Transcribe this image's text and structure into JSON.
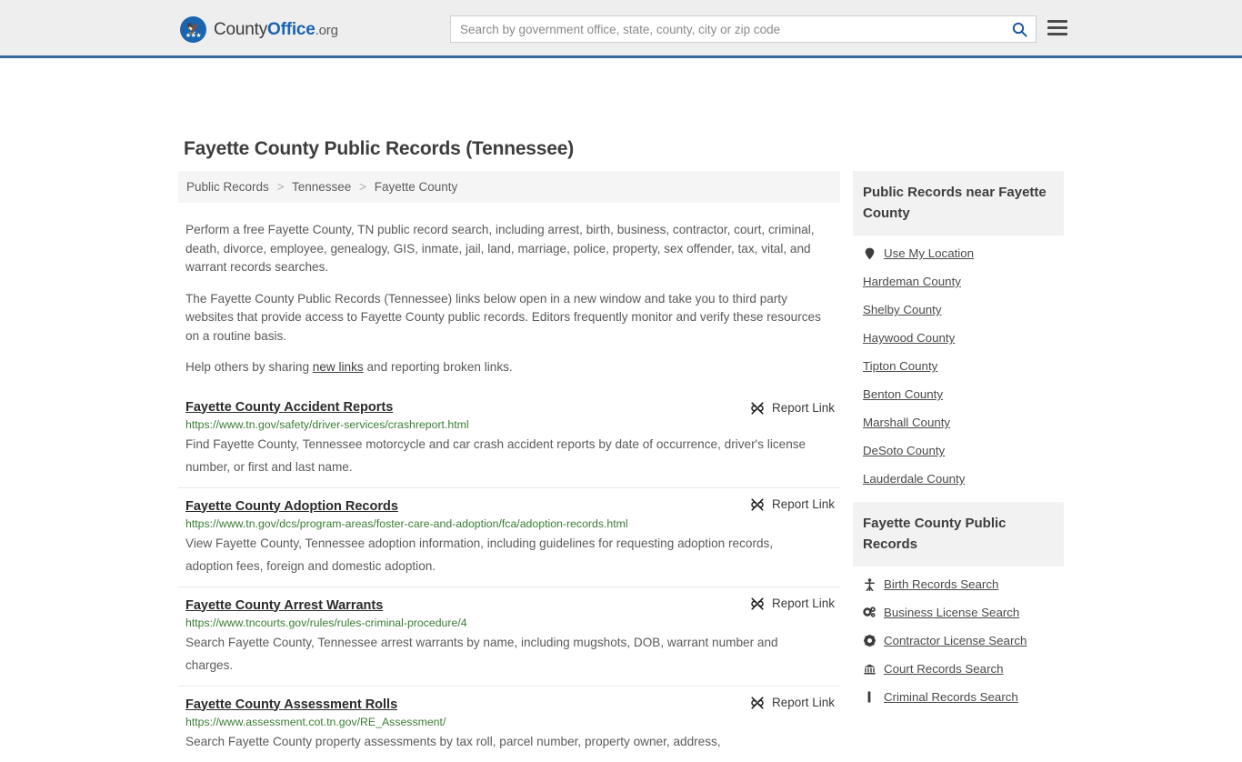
{
  "header": {
    "logo": {
      "prefix": "County",
      "bold": "Office",
      "suffix": ".org",
      "seal_icon": "eagle-seal-icon"
    },
    "search": {
      "placeholder": "Search by government office, state, county, city or zip code",
      "value": "",
      "search_icon": "search-icon"
    },
    "menu_icon": "hamburger-menu-icon"
  },
  "page": {
    "title": "Fayette County Public Records (Tennessee)"
  },
  "breadcrumb": {
    "separator": ">",
    "items": [
      {
        "label": "Public Records"
      },
      {
        "label": "Tennessee"
      },
      {
        "label": "Fayette County"
      }
    ]
  },
  "intro": {
    "p1": "Perform a free Fayette County, TN public record search, including arrest, birth, business, contractor, court, criminal, death, divorce, employee, genealogy, GIS, inmate, jail, land, marriage, police, property, sex offender, tax, vital, and warrant records searches.",
    "p2": "The Fayette County Public Records (Tennessee) links below open in a new window and take you to third party websites that provide access to Fayette County public records. Editors frequently monitor and verify these resources on a routine basis.",
    "p3_before": "Help others by sharing ",
    "p3_link": "new links",
    "p3_after": " and reporting broken links."
  },
  "results": {
    "report_label": "Report Link",
    "report_icon": "broken-link-icon",
    "items": [
      {
        "title": "Fayette County Accident Reports",
        "url": "https://www.tn.gov/safety/driver-services/crashreport.html",
        "description": "Find Fayette County, Tennessee motorcycle and car crash accident reports by date of occurrence, driver's license number, or first and last name."
      },
      {
        "title": "Fayette County Adoption Records",
        "url": "https://www.tn.gov/dcs/program-areas/foster-care-and-adoption/fca/adoption-records.html",
        "description": "View Fayette County, Tennessee adoption information, including guidelines for requesting adoption records, adoption fees, foreign and domestic adoption."
      },
      {
        "title": "Fayette County Arrest Warrants",
        "url": "https://www.tncourts.gov/rules/rules-criminal-procedure/4",
        "description": "Search Fayette County, Tennessee arrest warrants by name, including mugshots, DOB, warrant number and charges."
      },
      {
        "title": "Fayette County Assessment Rolls",
        "url": "https://www.assessment.cot.tn.gov/RE_Assessment/",
        "description": "Search Fayette County property assessments by tax roll, parcel number, property owner, address,"
      }
    ]
  },
  "sidebar": {
    "nearby": {
      "heading": "Public Records near Fayette County",
      "items": [
        {
          "label": "Use My Location",
          "icon": "map-pin-icon"
        },
        {
          "label": "Hardeman County",
          "icon": ""
        },
        {
          "label": "Shelby County",
          "icon": ""
        },
        {
          "label": "Haywood County",
          "icon": ""
        },
        {
          "label": "Tipton County",
          "icon": ""
        },
        {
          "label": "Benton County",
          "icon": ""
        },
        {
          "label": "Marshall County",
          "icon": ""
        },
        {
          "label": "DeSoto County",
          "icon": ""
        },
        {
          "label": "Lauderdale County",
          "icon": ""
        }
      ]
    },
    "records": {
      "heading": "Fayette County Public Records",
      "items": [
        {
          "label": "Birth Records Search",
          "icon": "baby-icon"
        },
        {
          "label": "Business License Search",
          "icon": "cogs-icon"
        },
        {
          "label": "Contractor License Search",
          "icon": "gear-icon"
        },
        {
          "label": "Court Records Search",
          "icon": "bank-icon"
        },
        {
          "label": "Criminal Records Search",
          "icon": "gavel-icon"
        }
      ]
    }
  },
  "colors": {
    "brand_blue": "#1a64b0",
    "header_border": "#36699c",
    "url_green": "#3a7d34",
    "card_gray": "#f2f2f2"
  }
}
